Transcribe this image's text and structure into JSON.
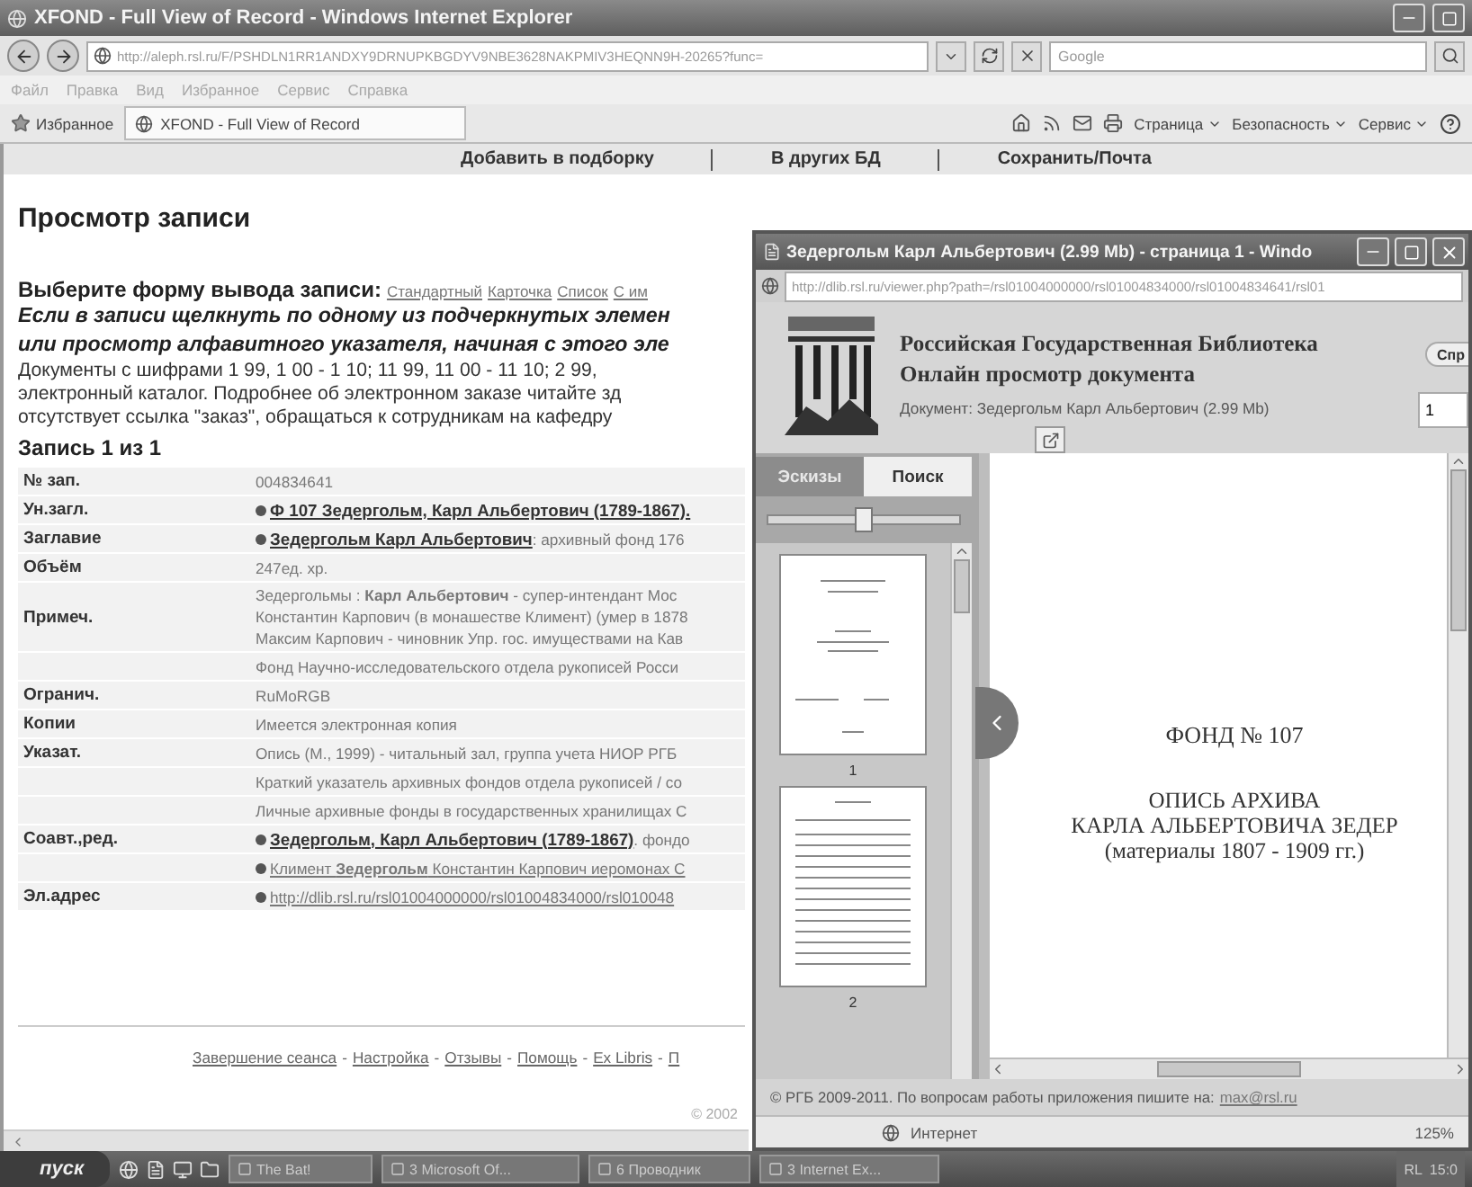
{
  "window": {
    "title": "XFOND - Full View of Record - Windows Internet Explorer"
  },
  "address_bar": {
    "url": "http://aleph.rsl.ru/F/PSHDLN1RR1ANDXY9DRNUPKBGDYV9NBE3628NAKPMIV3HEQNN9H-20265?func="
  },
  "search": {
    "placeholder": "Google"
  },
  "menu": [
    "Файл",
    "Правка",
    "Вид",
    "Избранное",
    "Сервис",
    "Справка"
  ],
  "favorites": {
    "label": "Избранное"
  },
  "tab": {
    "title": "XFOND - Full View of Record"
  },
  "command_bar": [
    "Страница",
    "Безопасность",
    "Сервис"
  ],
  "page": {
    "nav": [
      "Добавить в подборку",
      "В других БД",
      "Сохранить/Почта"
    ],
    "heading": "Просмотр записи",
    "format_label": "Выберите форму вывода записи:",
    "formats": [
      "Стандартный",
      "Карточка",
      "Список",
      "С им"
    ],
    "hint_lines": [
      "Если в записи щелкнуть по одному из подчеркнутых элемен",
      "или просмотр алфавитного указателя, начиная с этого эле"
    ],
    "info_lines": [
      "Документы с шифрами 1 99, 1 00 - 1 10; 11 99, 11 00 - 11 10; 2 99,",
      "электронный каталог. Подробнее об электронном заказе читайте зд",
      "отсутствует ссылка \"заказ\", обращаться к сотрудникам на кафедру"
    ],
    "record_counter": "Запись 1 из 1",
    "record": [
      {
        "label": "№ зап.",
        "lines": [
          {
            "kind": "text",
            "text": "004834641"
          }
        ]
      },
      {
        "label": "Ун.загл.",
        "lines": [
          {
            "kind": "link",
            "link": "Ф 107 Зедергольм, Карл Альбертович (1789-1867)."
          }
        ]
      },
      {
        "label": "Заглавие",
        "lines": [
          {
            "kind": "link",
            "link": "Зедергольм Карл Альбертович",
            "rest": " : архивный фонд 176"
          }
        ]
      },
      {
        "label": "Объём",
        "lines": [
          {
            "kind": "text",
            "text": "247ед. хр."
          }
        ]
      },
      {
        "label": "Примеч.",
        "lines": [
          {
            "kind": "text",
            "text": "Зедергольмы : **Карл Альбертович** - супер-интендант Мос"
          },
          {
            "kind": "text",
            "text": "Константин Карпович (в монашестве Климент) (умер в 1878"
          },
          {
            "kind": "text",
            "text": "Максим Карпович - чиновник Упр. гос. имуществами на Кав"
          }
        ]
      },
      {
        "lines": [
          {
            "kind": "text",
            "text": "Фонд Научно-исследовательского отдела рукописей Росси"
          }
        ]
      },
      {
        "label": "Огранич.",
        "lines": [
          {
            "kind": "text",
            "text": "RuMoRGB"
          }
        ]
      },
      {
        "label": "Копии",
        "lines": [
          {
            "kind": "text",
            "text": "Имеется электронная копия"
          }
        ]
      },
      {
        "label": "Указат.",
        "lines": [
          {
            "kind": "text",
            "text": "Опись (М., 1999) - читальный зал, группа учета НИОР РГБ"
          }
        ]
      },
      {
        "lines": [
          {
            "kind": "text",
            "text": "Краткий указатель архивных фондов отдела рукописей / со"
          }
        ]
      },
      {
        "lines": [
          {
            "kind": "text",
            "text": "Личные архивные фонды в государственных хранилищах С"
          }
        ]
      },
      {
        "label": "Соавт.,ред.",
        "lines": [
          {
            "kind": "link",
            "link": "Зедергольм, Карл Альбертович (1789-1867)",
            "rest": " . фондо"
          }
        ]
      },
      {
        "lines": [
          {
            "kind": "plainlink",
            "link": "Климент **Зедергольм** Константин Карпович иеромонах С"
          }
        ]
      },
      {
        "label": "Эл.адрес",
        "lines": [
          {
            "kind": "plainlink",
            "link": "http://dlib.rsl.ru/rsl01004000000/rsl01004834000/rsl010048"
          }
        ]
      }
    ],
    "footer_links": [
      "Завершение сеанса",
      "Настройка",
      "Отзывы",
      "Помощь",
      "Ex Libris",
      "П"
    ],
    "footer_separators": [
      "-",
      "-",
      "-",
      "-",
      "-"
    ],
    "copyright": "© 2002"
  },
  "popup": {
    "title": "Зедергольм Карл Альбертович (2.99 Mb) - страница 1 - Windo",
    "url": "http://dlib.rsl.ru/viewer.php?path=/rsl01004000000/rsl01004834000/rsl01004834641/rsl01",
    "library": "Российская Государственная Библиотека",
    "subtitle": "Онлайн просмотр документа",
    "document": "Документ: Зедергольм Карл Альбертович (2.99 Mb)",
    "help_button": "Спр",
    "page_number": "1",
    "tabs": [
      {
        "label": "Эскизы",
        "selected": true
      },
      {
        "label": "Поиск",
        "selected": false
      }
    ],
    "zoom": {
      "level": 0.5
    },
    "thumbnails": [
      {
        "label": "1"
      },
      {
        "label": "2"
      }
    ],
    "page_lines": [
      {
        "kind": "title",
        "text": "ФОНД  № 107"
      },
      {
        "kind": "line",
        "text": "ОПИСЬ АРХИВА"
      },
      {
        "kind": "line",
        "text": "КАРЛА АЛЬБЕРТОВИЧА ЗЕДЕР"
      },
      {
        "kind": "line",
        "text": "(материалы 1807 - 1909 гг.)"
      }
    ],
    "footer": "© РГБ 2009-2011. По вопросам работы приложения пишите на:",
    "footer_link": "max@rsl.ru",
    "status": {
      "zone": "Интернет",
      "zoom": "125%"
    }
  },
  "taskbar": {
    "start": "пуск",
    "tasks": [
      "The Bat!",
      "3 Microsoft Of...",
      "6 Проводник",
      "3 Internet Ex..."
    ],
    "tray_label": "RL",
    "clock": "15:0"
  }
}
